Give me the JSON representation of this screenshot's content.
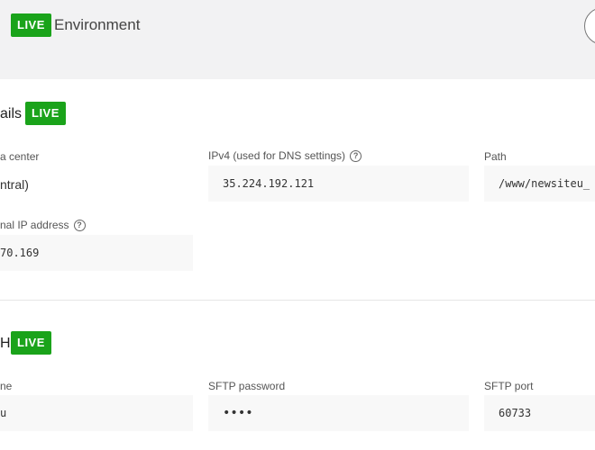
{
  "header": {
    "live_badge": "LIVE",
    "title": "Environment"
  },
  "details_section": {
    "title_fragment": "ails",
    "live_badge": "LIVE",
    "data_center": {
      "label": "a center",
      "value": "ntral)"
    },
    "ipv4": {
      "label": "IPv4 (used for DNS settings)",
      "value": "35.224.192.121"
    },
    "path": {
      "label": "Path",
      "value": "/www/newsiteu_"
    },
    "external_ip": {
      "label": "nal IP address",
      "value": "70.169"
    }
  },
  "sftp_section": {
    "title_fragment": "H",
    "live_badge": "LIVE",
    "username": {
      "label": "ne",
      "value": "u"
    },
    "password": {
      "label": "SFTP password",
      "value": "••••"
    },
    "port": {
      "label": "SFTP port",
      "value": "60733"
    }
  },
  "colors": {
    "live_green": "#1aa31a",
    "header_bg": "#f2f2f3",
    "field_bg": "#f8f8f8"
  },
  "icons": {
    "help": "help-circle-icon"
  }
}
